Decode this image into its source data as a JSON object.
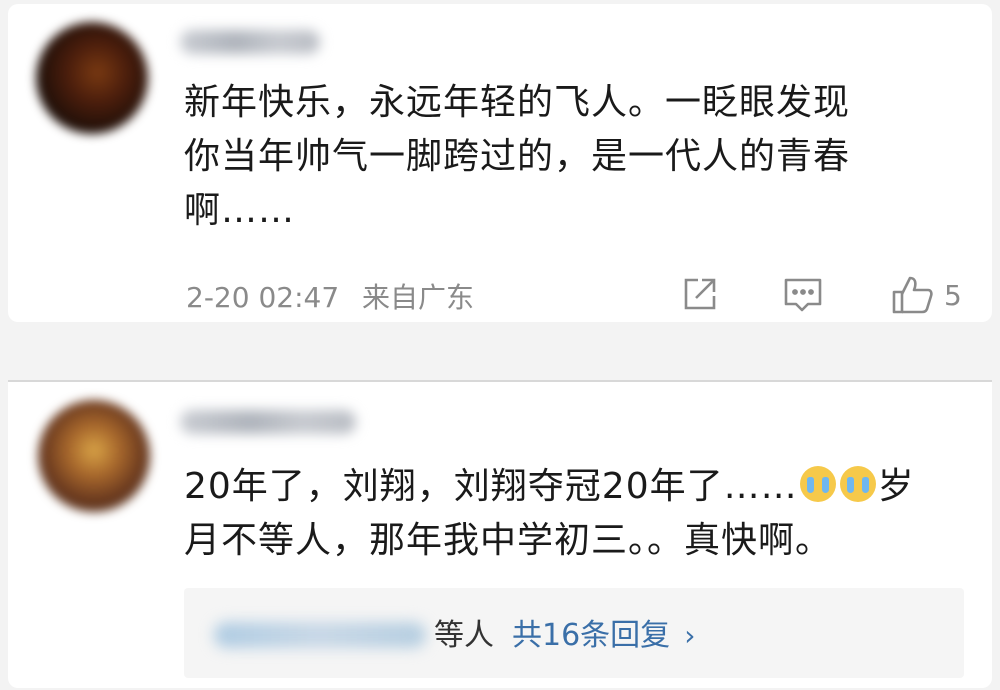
{
  "comments": [
    {
      "text": "新年快乐，永远年轻的飞人。一眨眼发现\n你当年帅气一脚跨过的，是一代人的青春\n啊……",
      "time": "2-20 02:47",
      "location": "来自广东",
      "like_count": "5",
      "icons": [
        "share-icon",
        "comment-icon",
        "like-icon"
      ]
    },
    {
      "text_part1": "20年了，刘翔，刘翔夺冠20年了……",
      "emoji": "crying-emoji",
      "text_part2": "岁\n月不等人，那年我中学初三。。真快啊。",
      "reply": {
        "suffix": "等人",
        "link": "共16条回复",
        "chevron": "›"
      }
    }
  ],
  "colors": {
    "background": "#f3f3f3",
    "card": "#ffffff",
    "text": "#1a1a1a",
    "meta": "#8a8a8a",
    "link": "#3a6fa8"
  }
}
